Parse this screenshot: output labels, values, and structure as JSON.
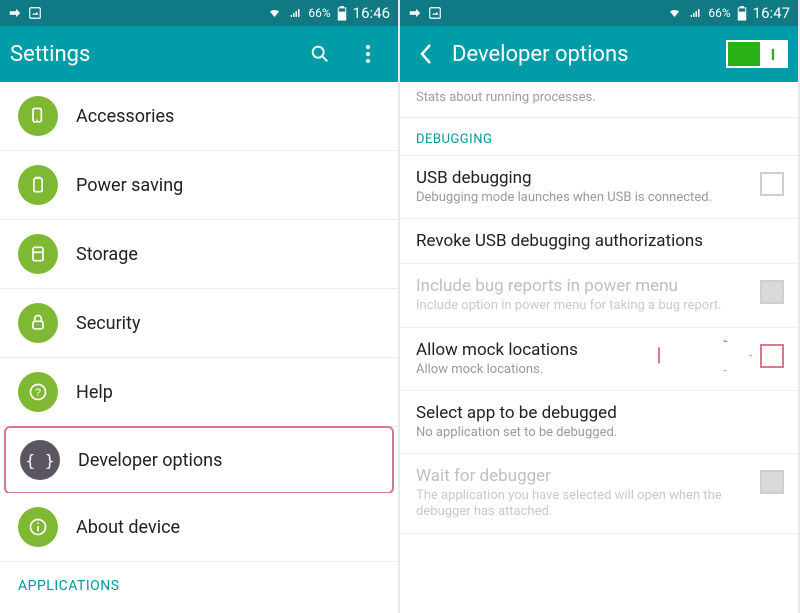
{
  "left": {
    "status": {
      "battery": "66%",
      "time": "16:46"
    },
    "appbar_title": "Settings",
    "items": [
      {
        "label": "Accessories"
      },
      {
        "label": "Power saving"
      },
      {
        "label": "Storage"
      },
      {
        "label": "Security"
      },
      {
        "label": "Help"
      },
      {
        "label": "Developer options"
      },
      {
        "label": "About device"
      }
    ],
    "section_header": "APPLICATIONS"
  },
  "right": {
    "status": {
      "battery": "66%",
      "time": "16:47"
    },
    "appbar_title": "Developer options",
    "toggle_on_label": "I",
    "stub_sub": "Stats about running processes.",
    "section": "DEBUGGING",
    "rows": {
      "usb": {
        "title": "USB debugging",
        "sub": "Debugging mode launches when USB is connected."
      },
      "revoke": {
        "title": "Revoke USB debugging authorizations"
      },
      "bugrep": {
        "title": "Include bug reports in power menu",
        "sub": "Include option in power menu for taking a bug report."
      },
      "mock": {
        "title": "Allow mock locations",
        "sub": "Allow mock locations."
      },
      "selapp": {
        "title": "Select app to be debugged",
        "sub": "No application set to be debugged."
      },
      "wait": {
        "title": "Wait for debugger",
        "sub": "The application you have selected will open when the debugger has attached."
      }
    }
  }
}
